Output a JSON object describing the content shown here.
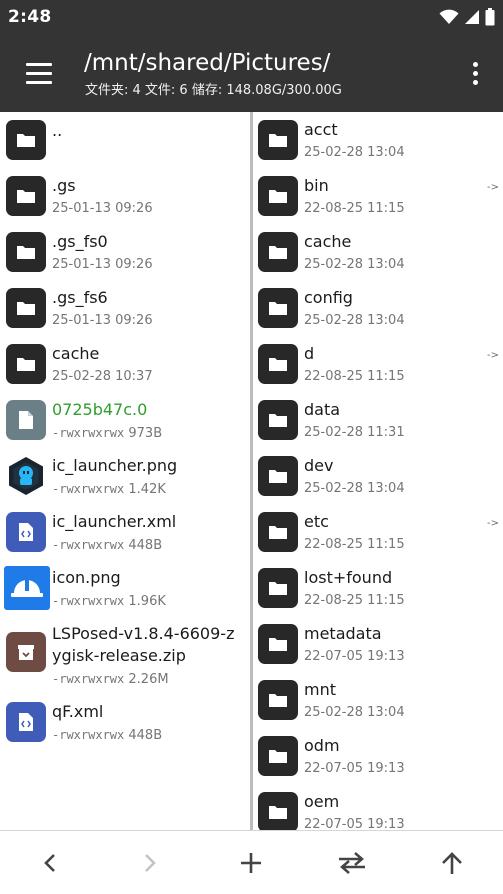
{
  "status": {
    "time": "2:48"
  },
  "toolbar": {
    "title": "/mnt/shared/Pictures/",
    "subtitle": "文件夹: 4  文件: 6  储存: 148.08G/300.00G"
  },
  "left_pane": {
    "items": [
      {
        "name": "..",
        "meta": "",
        "icon": "folder-icon"
      },
      {
        "name": ".gs",
        "meta": "25-01-13 09:26",
        "icon": "folder-icon"
      },
      {
        "name": ".gs_fs0",
        "meta": "25-01-13 09:26",
        "icon": "folder-icon"
      },
      {
        "name": ".gs_fs6",
        "meta": "25-01-13 09:26",
        "icon": "folder-icon"
      },
      {
        "name": "cache",
        "meta": "25-02-28 10:37",
        "icon": "folder-icon"
      },
      {
        "name": "0725b47c.0",
        "perm": "-rwxrwxrwx",
        "size": "973B",
        "icon": "file-icon",
        "color": "#2e9e2e"
      },
      {
        "name": "ic_launcher.png",
        "perm": "-rwxrwxrwx",
        "size": "1.42K",
        "icon": "launcher-image-icon"
      },
      {
        "name": "ic_launcher.xml",
        "perm": "-rwxrwxrwx",
        "size": "448B",
        "icon": "xml-file-icon"
      },
      {
        "name": "icon.png",
        "perm": "-rwxrwxrwx",
        "size": "1.96K",
        "icon": "helmet-image-icon"
      },
      {
        "name_line1": "LSPosed-v1.8.4-6609-z",
        "name_line2": "ygisk-release.zip",
        "perm": "-rwxrwxrwx",
        "size": "2.26M",
        "icon": "archive-icon"
      },
      {
        "name": "qF.xml",
        "perm": "-rwxrwxrwx",
        "size": "448B",
        "icon": "xml-file-icon"
      }
    ]
  },
  "right_pane": {
    "items": [
      {
        "name": "acct",
        "meta": "25-02-28 13:04",
        "link": ""
      },
      {
        "name": "bin",
        "meta": "22-08-25 11:15",
        "link": "->"
      },
      {
        "name": "cache",
        "meta": "25-02-28 13:04",
        "link": ""
      },
      {
        "name": "config",
        "meta": "25-02-28 13:04",
        "link": ""
      },
      {
        "name": "d",
        "meta": "22-08-25 11:15",
        "link": "->"
      },
      {
        "name": "data",
        "meta": "25-02-28 11:31",
        "link": ""
      },
      {
        "name": "dev",
        "meta": "25-02-28 13:04",
        "link": ""
      },
      {
        "name": "etc",
        "meta": "22-08-25 11:15",
        "link": "->"
      },
      {
        "name": "lost+found",
        "meta": "22-08-25 11:15",
        "link": ""
      },
      {
        "name": "metadata",
        "meta": "22-07-05 19:13",
        "link": ""
      },
      {
        "name": "mnt",
        "meta": "25-02-28 13:04",
        "link": ""
      },
      {
        "name": "odm",
        "meta": "22-07-05 19:13",
        "link": ""
      },
      {
        "name": "oem",
        "meta": "22-07-05 19:13",
        "link": ""
      }
    ]
  },
  "bottom_bar": {
    "buttons": [
      "back-icon",
      "forward-icon",
      "add-icon",
      "swap-icon",
      "up-icon"
    ]
  },
  "colors": {
    "bar_bg": "#343434",
    "folder_bg": "#282828",
    "file_bg": "#6b7f86",
    "xml_bg": "#3e5cb8",
    "archive_bg": "#6e4b43",
    "helmet_bg": "#1e7be8",
    "green_text": "#2e9e2e"
  }
}
